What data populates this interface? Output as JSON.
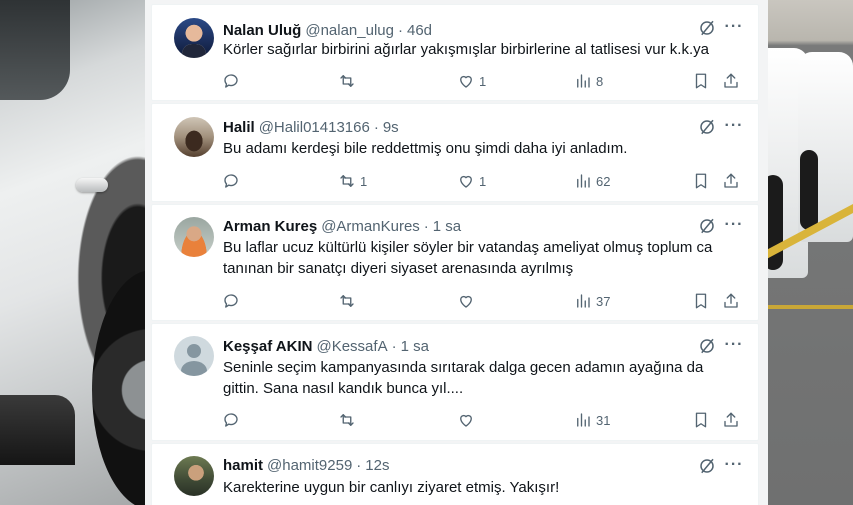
{
  "tweets": [
    {
      "name": "Nalan Uluğ",
      "handle": "@nalan_ulug",
      "dot": "·",
      "time": "46d",
      "lines": [
        "Körler sağırlar birbirini ağırlar yakışmışlar birbirlerine al tatlisesi vur k.k.ya"
      ],
      "reply": "",
      "retweet": "",
      "like": "1",
      "views": "8",
      "avatar": "avatar-nalan"
    },
    {
      "name": "Halil",
      "handle": "@Halil01413166",
      "dot": "·",
      "time": "9s",
      "lines": [
        "Bu adamı kerdeşi bile reddettmiş onu  şimdi daha iyi anladım."
      ],
      "reply": "",
      "retweet": "1",
      "like": "1",
      "views": "62",
      "avatar": "avatar-halil"
    },
    {
      "name": "Arman Kureş",
      "handle": "@ArmanKures",
      "dot": "·",
      "time": "1 sa",
      "lines": [
        "Bu laflar ucuz kültürlü kişiler söyler bir vatandaş ameliyat olmuş toplum ca",
        "tanınan bir sanatçı diyeri siyaset arenasında ayrılmış"
      ],
      "reply": "",
      "retweet": "",
      "like": "",
      "views": "37",
      "avatar": "avatar-arman"
    },
    {
      "name": "Keşşaf AKIN",
      "handle": "@KessafA",
      "dot": "·",
      "time": "1 sa",
      "lines": [
        "Seninle seçim kampanyasında sırıtarak dalga gecen adamın ayağına da",
        "gittin. Sana nasıl kandık bunca yıl...."
      ],
      "reply": "",
      "retweet": "",
      "like": "",
      "views": "31",
      "avatar": "avatar-kessaf"
    },
    {
      "name": "hamit",
      "handle": "@hamit9259",
      "dot": "·",
      "time": "12s",
      "lines": [
        "Karekterine uygun bir canlıyı ziyaret etmiş. Yakışır!"
      ],
      "reply": "",
      "retweet": "",
      "like": "",
      "views": "",
      "avatar": "avatar-hamit"
    }
  ],
  "icons": {
    "grok": "grok-icon",
    "more": "more-icon",
    "more_glyph": "···",
    "reply": "reply-icon",
    "retweet": "retweet-icon",
    "like": "heart-icon",
    "views": "views-icon",
    "bookmark": "bookmark-icon",
    "share": "share-icon"
  },
  "colors": {
    "text": "#0f1419",
    "secondary": "#536471",
    "background": "#ffffff"
  }
}
